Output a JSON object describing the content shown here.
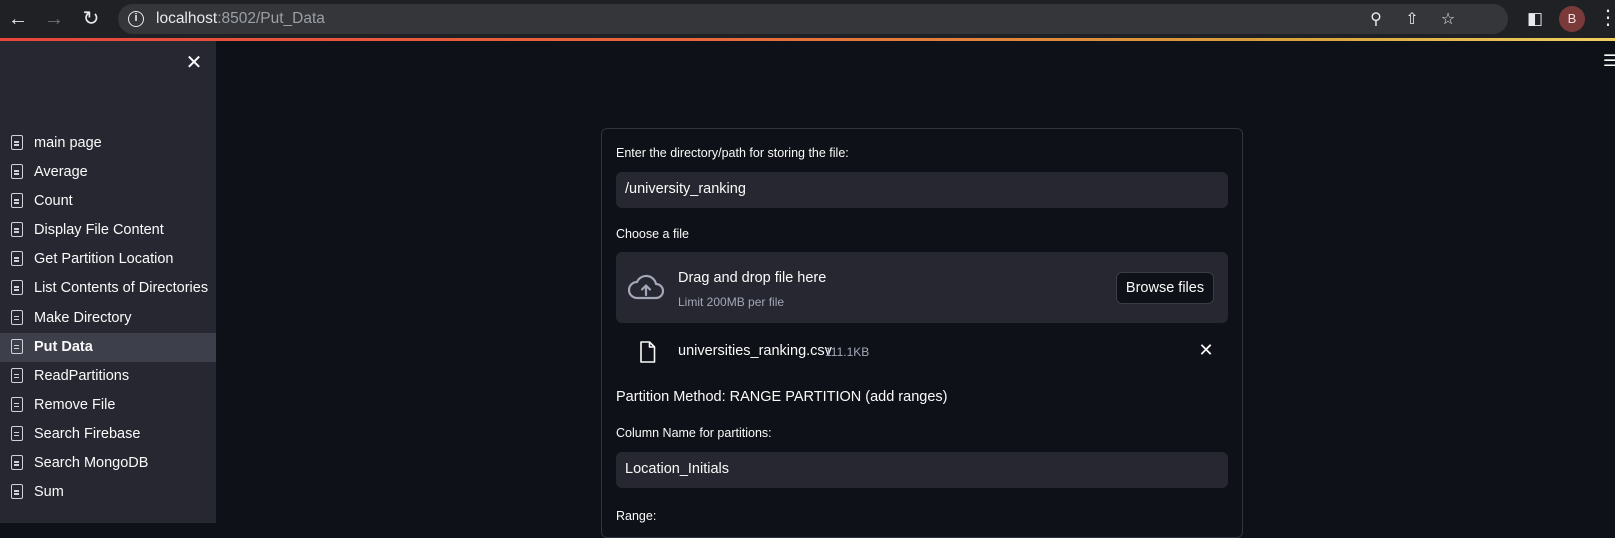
{
  "browser": {
    "url_host": "localhost",
    "url_path": ":8502/Put_Data",
    "avatar_letter": "B"
  },
  "sidebar": {
    "items": [
      {
        "label": "main page"
      },
      {
        "label": "Average"
      },
      {
        "label": "Count"
      },
      {
        "label": "Display File Content"
      },
      {
        "label": "Get Partition Location"
      },
      {
        "label": "List Contents of Directories"
      },
      {
        "label": "Make Directory"
      },
      {
        "label": "Put Data",
        "active": true
      },
      {
        "label": "ReadPartitions"
      },
      {
        "label": "Remove File"
      },
      {
        "label": "Search Firebase"
      },
      {
        "label": "Search MongoDB"
      },
      {
        "label": "Sum"
      }
    ]
  },
  "form": {
    "path_label": "Enter the directory/path for storing the file:",
    "path_value": "/university_ranking",
    "file_label": "Choose a file",
    "dropzone_title": "Drag and drop file here",
    "dropzone_limit": "Limit 200MB per file",
    "browse_label": "Browse files",
    "uploaded_file_name": "universities_ranking.csv",
    "uploaded_file_size": "111.1KB",
    "partition_method": "Partition Method: RANGE PARTITION (add ranges)",
    "column_label": "Column Name for partitions:",
    "column_value": "Location_Initials",
    "range_label": "Range:"
  },
  "colors": {
    "app_background": "#0e1117",
    "sidebar_background": "#262730",
    "input_background": "#262730",
    "text": "#fafafa"
  }
}
